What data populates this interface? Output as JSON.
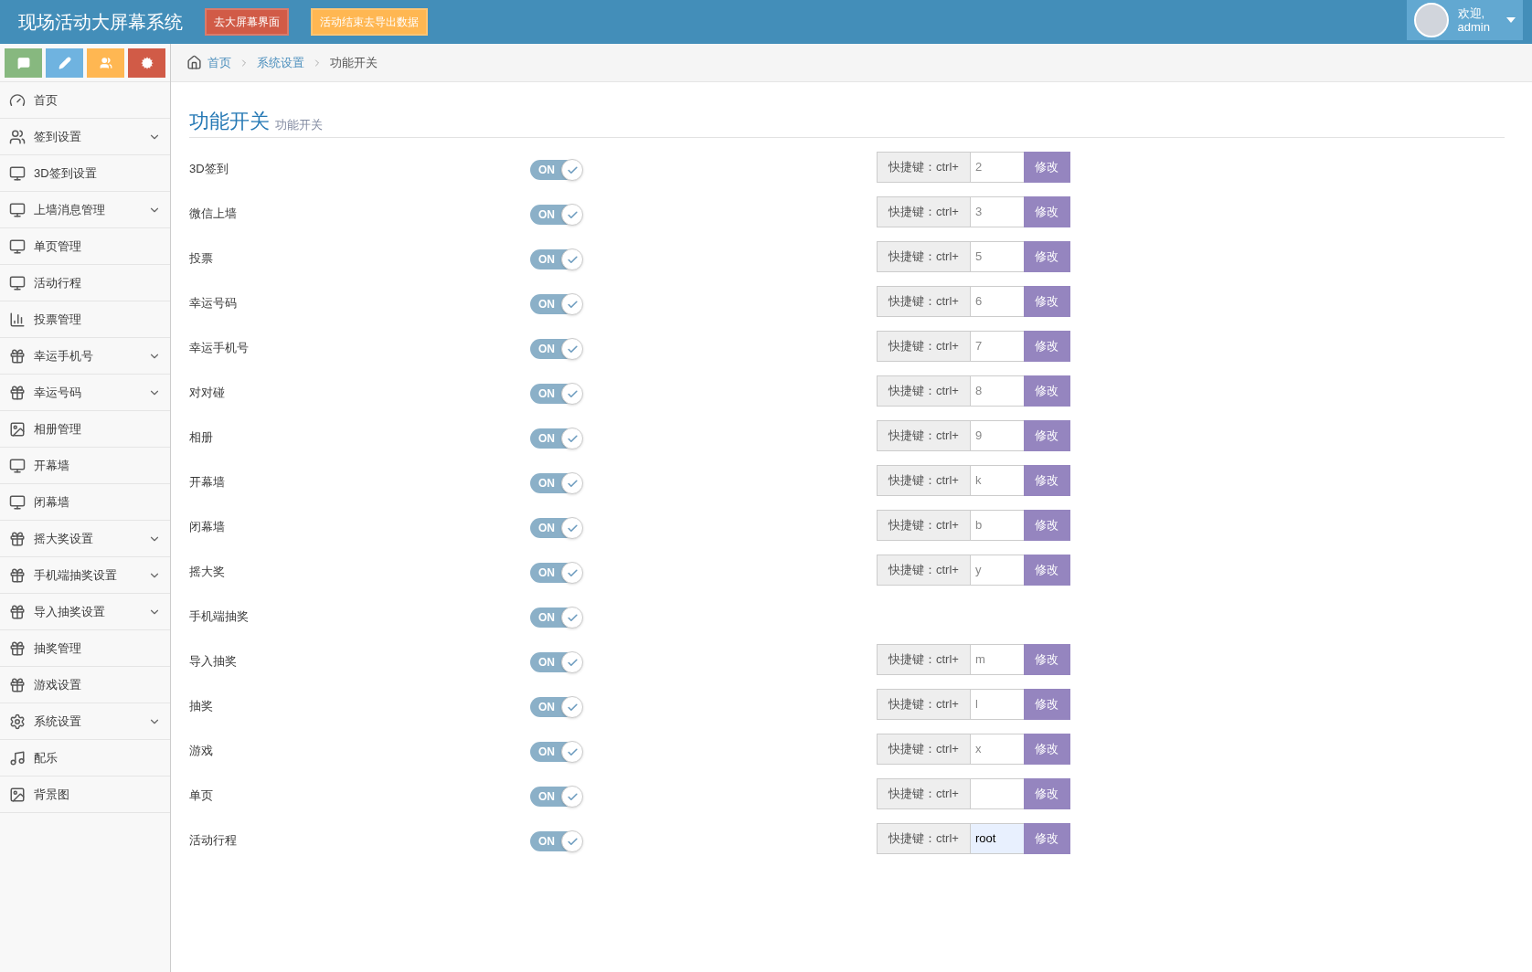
{
  "header": {
    "title": "现场活动大屏幕系统",
    "buttons": [
      {
        "label": "去大屏幕界面",
        "kind": "danger"
      },
      {
        "label": "活动结束去导出数据",
        "kind": "warning"
      }
    ],
    "user": {
      "greeting": "欢迎,",
      "name": "admin"
    }
  },
  "shortcut_buttons": [
    {
      "kind": "chat",
      "color": "#87b87f"
    },
    {
      "kind": "edit",
      "color": "#6fb3e0"
    },
    {
      "kind": "users",
      "color": "#ffb752"
    },
    {
      "kind": "cogs",
      "color": "#d15b47"
    }
  ],
  "sidebar": {
    "items": [
      {
        "label": "首页",
        "kind": "dashboard",
        "expandable": false
      },
      {
        "label": "签到设置",
        "kind": "users",
        "expandable": true
      },
      {
        "label": "3D签到设置",
        "kind": "monitor",
        "expandable": false
      },
      {
        "label": "上墙消息管理",
        "kind": "monitor",
        "expandable": true
      },
      {
        "label": "单页管理",
        "kind": "monitor",
        "expandable": false
      },
      {
        "label": "活动行程",
        "kind": "monitor",
        "expandable": false
      },
      {
        "label": "投票管理",
        "kind": "signal",
        "expandable": false
      },
      {
        "label": "幸运手机号",
        "kind": "gift",
        "expandable": true
      },
      {
        "label": "幸运号码",
        "kind": "gift",
        "expandable": true
      },
      {
        "label": "相册管理",
        "kind": "picture",
        "expandable": false
      },
      {
        "label": "开幕墙",
        "kind": "monitor",
        "expandable": false
      },
      {
        "label": "闭幕墙",
        "kind": "monitor",
        "expandable": false
      },
      {
        "label": "摇大奖设置",
        "kind": "gift",
        "expandable": true
      },
      {
        "label": "手机端抽奖设置",
        "kind": "gift",
        "expandable": true
      },
      {
        "label": "导入抽奖设置",
        "kind": "gift",
        "expandable": true
      },
      {
        "label": "抽奖管理",
        "kind": "gift",
        "expandable": false
      },
      {
        "label": "游戏设置",
        "kind": "gift",
        "expandable": false
      },
      {
        "label": "系统设置",
        "kind": "cog",
        "expandable": true
      },
      {
        "label": "配乐",
        "kind": "music",
        "expandable": false
      },
      {
        "label": "背景图",
        "kind": "picture",
        "expandable": false
      }
    ]
  },
  "breadcrumb": [
    "首页",
    "系统设置",
    "功能开关"
  ],
  "page": {
    "title": "功能开关",
    "subtitle": "功能开关"
  },
  "features": [
    {
      "label": "3D签到",
      "on": true,
      "toggle_text": "ON",
      "shortcut": {
        "prefix": "快捷键：ctrl+",
        "value": "2",
        "highlighted": false,
        "button": "修改"
      }
    },
    {
      "label": "微信上墙",
      "on": true,
      "toggle_text": "ON",
      "shortcut": {
        "prefix": "快捷键：ctrl+",
        "value": "3",
        "highlighted": false,
        "button": "修改"
      }
    },
    {
      "label": "投票",
      "on": true,
      "toggle_text": "ON",
      "shortcut": {
        "prefix": "快捷键：ctrl+",
        "value": "5",
        "highlighted": false,
        "button": "修改"
      }
    },
    {
      "label": "幸运号码",
      "on": true,
      "toggle_text": "ON",
      "shortcut": {
        "prefix": "快捷键：ctrl+",
        "value": "6",
        "highlighted": false,
        "button": "修改"
      }
    },
    {
      "label": "幸运手机号",
      "on": true,
      "toggle_text": "ON",
      "shortcut": {
        "prefix": "快捷键：ctrl+",
        "value": "7",
        "highlighted": false,
        "button": "修改"
      }
    },
    {
      "label": "对对碰",
      "on": true,
      "toggle_text": "ON",
      "shortcut": {
        "prefix": "快捷键：ctrl+",
        "value": "8",
        "highlighted": false,
        "button": "修改"
      }
    },
    {
      "label": "相册",
      "on": true,
      "toggle_text": "ON",
      "shortcut": {
        "prefix": "快捷键：ctrl+",
        "value": "9",
        "highlighted": false,
        "button": "修改"
      }
    },
    {
      "label": "开幕墙",
      "on": true,
      "toggle_text": "ON",
      "shortcut": {
        "prefix": "快捷键：ctrl+",
        "value": "k",
        "highlighted": false,
        "button": "修改"
      }
    },
    {
      "label": "闭幕墙",
      "on": true,
      "toggle_text": "ON",
      "shortcut": {
        "prefix": "快捷键：ctrl+",
        "value": "b",
        "highlighted": false,
        "button": "修改"
      }
    },
    {
      "label": "摇大奖",
      "on": true,
      "toggle_text": "ON",
      "shortcut": {
        "prefix": "快捷键：ctrl+",
        "value": "y",
        "highlighted": false,
        "button": "修改"
      }
    },
    {
      "label": "手机端抽奖",
      "on": true,
      "toggle_text": "ON"
    },
    {
      "label": "导入抽奖",
      "on": true,
      "toggle_text": "ON",
      "shortcut": {
        "prefix": "快捷键：ctrl+",
        "value": "m",
        "highlighted": false,
        "button": "修改"
      }
    },
    {
      "label": "抽奖",
      "on": true,
      "toggle_text": "ON",
      "shortcut": {
        "prefix": "快捷键：ctrl+",
        "value": "l",
        "highlighted": false,
        "button": "修改"
      }
    },
    {
      "label": "游戏",
      "on": true,
      "toggle_text": "ON",
      "shortcut": {
        "prefix": "快捷键：ctrl+",
        "value": "x",
        "highlighted": false,
        "button": "修改"
      }
    },
    {
      "label": "单页",
      "on": true,
      "toggle_text": "ON",
      "shortcut": {
        "prefix": "快捷键：ctrl+",
        "highlighted": false,
        "button": "修改"
      }
    },
    {
      "label": "活动行程",
      "on": true,
      "toggle_text": "ON",
      "shortcut": {
        "prefix": "快捷键：ctrl+",
        "value": "root",
        "highlighted": true,
        "button": "修改"
      }
    }
  ]
}
